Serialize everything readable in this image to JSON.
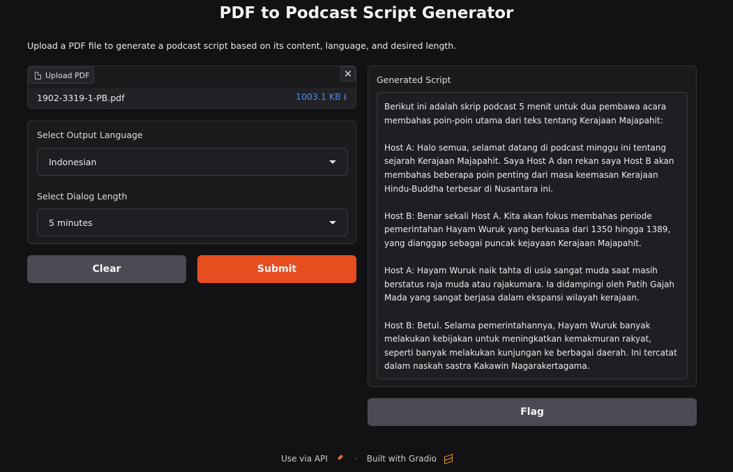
{
  "header": {
    "title": "PDF to Podcast Script Generator",
    "subtitle": "Upload a PDF file to generate a podcast script based on its content, language, and desired length."
  },
  "upload": {
    "tab_label": "Upload PDF",
    "close_symbol": "✕",
    "file_name": "1902-3319-1-PB.pdf",
    "file_size": "1003.1 KB ⭳"
  },
  "settings": {
    "language_label": "Select Output Language",
    "language_value": "Indonesian",
    "length_label": "Select Dialog Length",
    "length_value": "5 minutes"
  },
  "actions": {
    "clear_label": "Clear",
    "submit_label": "Submit",
    "flag_label": "Flag"
  },
  "output": {
    "label": "Generated Script",
    "text": "Berikut ini adalah skrip podcast 5 menit untuk dua pembawa acara membahas poin-poin utama dari teks tentang Kerajaan Majapahit:\n\nHost A: Halo semua, selamat datang di podcast minggu ini tentang sejarah Kerajaan Majapahit. Saya Host A dan rekan saya Host B akan membahas beberapa poin penting dari masa keemasan Kerajaan Hindu-Buddha terbesar di Nusantara ini.\n\nHost B: Benar sekali Host A. Kita akan fokus membahas periode pemerintahan Hayam Wuruk yang berkuasa dari 1350 hingga 1389, yang dianggap sebagai puncak kejayaan Kerajaan Majapahit.\n\nHost A: Hayam Wuruk naik tahta di usia sangat muda saat masih berstatus raja muda atau rajakumara. Ia didampingi oleh Patih Gajah Mada yang sangat berjasa dalam ekspansi wilayah kerajaan.\n\nHost B: Betul. Selama pemerintahannya, Hayam Wuruk banyak melakukan kebijakan untuk meningkatkan kemakmuran rakyat, seperti banyak melakukan kunjungan ke berbagai daerah. Ini tercatat dalam naskah sastra Kakawin Nagarakertagama."
  },
  "footer": {
    "api_label": "Use via API",
    "separator": "·",
    "built_label": "Built with Gradio"
  },
  "colors": {
    "accent": "#e64d1f",
    "file_size": "#4f8ef0",
    "background": "#121214"
  }
}
